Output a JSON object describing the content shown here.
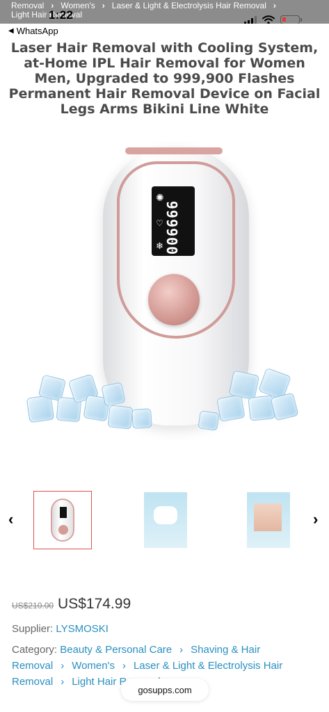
{
  "status_bar": {
    "time": "1:22",
    "battery_color": "#e53935"
  },
  "scrolled_breadcrumb": {
    "row1": [
      "Removal",
      "Women's",
      "Laser & Light & Electrolysis Hair Removal"
    ],
    "row2": "Light Hair Removal"
  },
  "back_app": {
    "label": "WhatsApp"
  },
  "product": {
    "title": "Laser Hair Removal with Cooling System, at-Home IPL Hair Removal for Women Men, Upgraded to 999,900 Flashes Permanent Hair Removal Device on Facial Legs Arms Bikini Line White",
    "display_value": "999900",
    "old_price": "US$210.00",
    "price": "US$174.99",
    "supplier_label": "Supplier:",
    "supplier": "LYSMOSKI",
    "category_label": "Category:",
    "categories": [
      "Beauty & Personal Care",
      "Shaving & Hair Removal",
      "Women's",
      "Laser & Light & Electrolysis Hair Removal",
      "Light Hair Removal"
    ]
  },
  "gallery": {
    "prev_icon": "chevron-left-icon",
    "next_icon": "chevron-right-icon",
    "selected_index": 0,
    "thumbnails": 3
  },
  "browser": {
    "url": "gosupps.com"
  },
  "colors": {
    "link": "#2a8fc1",
    "selected_border": "#d9534f",
    "accent_pink": "#d09b98"
  }
}
